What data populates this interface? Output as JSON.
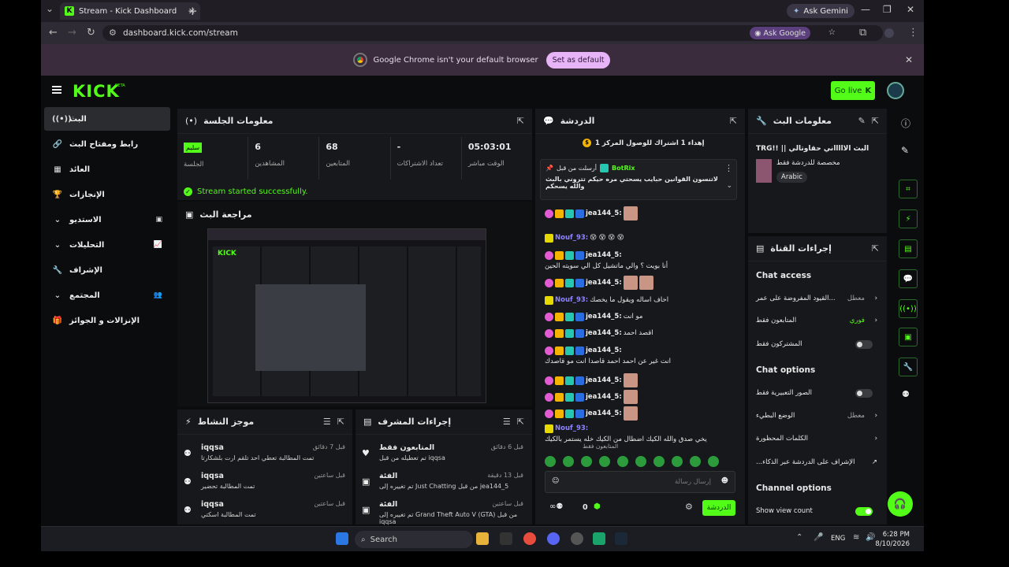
{
  "browser": {
    "tab_title": "Stream - Kick Dashboard",
    "url": "dashboard.kick.com/stream",
    "ask_gemini": "Ask Gemini",
    "ask_google": "Ask Google",
    "infobar_text": "Google Chrome isn't your default browser",
    "set_default": "Set as default"
  },
  "header": {
    "logo": "KICK",
    "beta": "BETA",
    "go_live": "Go live"
  },
  "sidebar": {
    "items": [
      {
        "label": "البث",
        "icon": "((•))"
      },
      {
        "label": "رابط ومفتاح البث",
        "icon": "🔗"
      },
      {
        "label": "العائد",
        "icon": "▦"
      },
      {
        "label": "الإنجازات",
        "icon": "🏆"
      },
      {
        "label": "الاستديو",
        "icon": "▣"
      },
      {
        "label": "التحليلات",
        "icon": "📈"
      },
      {
        "label": "الإشراف",
        "icon": "🔧"
      },
      {
        "label": "المجتمع",
        "icon": "👥"
      },
      {
        "label": "الإنزالات و الجوائز",
        "icon": "🎁"
      }
    ]
  },
  "session": {
    "title": "معلومات الجلسة",
    "stats": [
      {
        "value": "سليم",
        "label": "الجلسة"
      },
      {
        "value": "6",
        "label": "المشاهدين"
      },
      {
        "value": "68",
        "label": "المتابعين"
      },
      {
        "value": "-",
        "label": "تعداد الاشتراكات"
      },
      {
        "value": "05:03:01",
        "label": "الوقت مباشر"
      }
    ],
    "success": "Stream started successfully.",
    "preview_title": "مراجعة البث"
  },
  "activity": {
    "title": "موجز النشاط",
    "rows": [
      {
        "name": "iqqsa",
        "desc": "تمت المطالبة تعطي احد تلقم ارت بلشكارتا",
        "time": "قبل 7 دقائق"
      },
      {
        "name": "iqqsa",
        "desc": "تمت المطالبة تحضير",
        "time": "قبل ساعتين"
      },
      {
        "name": "iqqsa",
        "desc": "تمت المطالبة اسكتي",
        "time": "قبل ساعتين"
      }
    ]
  },
  "mod": {
    "title": "إجراءات المشرف",
    "rows": [
      {
        "name": "المتابعون فقط",
        "desc": "تم تعطيله من قبل iqqsa",
        "time": "قبل 6 دقائق"
      },
      {
        "name": "الفئة",
        "desc": "تم تغييره إلى Just Chatting من قبل jea144_5",
        "time": "قبل 13 دقيقة"
      },
      {
        "name": "الفئة",
        "desc": "تم تغييره إلى Grand Theft Auto V (GTA) من قبل iqqsa",
        "time": "قبل ساعتين"
      }
    ]
  },
  "chat": {
    "title": "الدردشة",
    "banner": "إهداء 1 اشتراك للوصول المركز 1",
    "pinned_by": "أرسلت من قبل",
    "pinned_user": "BotRix",
    "pinned_text": "لاتنسون القوانين حبايب يسحتي مره حيكم تتروني بالبث واللّه يسحكم",
    "messages": [
      {
        "user": "jea144_5:",
        "text": ""
      },
      {
        "user": "Nouf_93:",
        "text": "😵 😵 😵 😵"
      },
      {
        "user": "jea144_5:",
        "text": "أنا بويت ؟ والي ماتشيل كل الي سويته الحين"
      },
      {
        "user": "jea144_5:",
        "text": ""
      },
      {
        "user": "Nouf_93:",
        "text": "اخاف اساله ويقول ما يخصك"
      },
      {
        "user": "jea144_5:",
        "text": "مو انت"
      },
      {
        "user": "jea144_5:",
        "text": "اقصد احمد"
      },
      {
        "user": "jea144_5:",
        "text": "انت غير عن احمد احمد قاصدا انت مو قاصدك"
      },
      {
        "user": "jea144_5:",
        "text": ""
      },
      {
        "user": "jea144_5:",
        "text": ""
      },
      {
        "user": "jea144_5:",
        "text": ""
      },
      {
        "user": "Nouf_93:",
        "text": "يخي صدق والله الكيك اضطال من الكيك خله يستمر بالكيك"
      }
    ],
    "followers_only": "المتابعون فقط",
    "input_placeholder": "إرسال رسالة",
    "points": "0",
    "send": "الدردشة"
  },
  "stream_info": {
    "title": "معلومات البث",
    "stream_title": "TRG!! || البث الاااااني حقاوتالي",
    "subtitle": "مخصصة للدردشة فقط",
    "tag": "Arabic"
  },
  "channel_actions": {
    "title": "إجراءات القناة",
    "chat_access": "Chat access",
    "rows_access": [
      {
        "label": "القيود المفروضة على عمر...",
        "value": "معطل"
      },
      {
        "label": "المتابعون فقط",
        "value": "فوري"
      },
      {
        "label": "المشتركون فقط",
        "value": ""
      }
    ],
    "chat_options": "Chat options",
    "rows_options": [
      {
        "label": "الصور التعبيرية فقط",
        "value": ""
      },
      {
        "label": "الوضع البطيء",
        "value": "معطل"
      },
      {
        "label": "الكلمات المحظورة",
        "value": ""
      },
      {
        "label": "...الإشراف على الدردشة عبر الذكاء",
        "value": ""
      }
    ],
    "channel_options": "Channel options",
    "show_view_count": "Show view count"
  },
  "taskbar": {
    "search": "Search",
    "lang": "ENG",
    "time": "6:28 PM",
    "date": "8/10/2026"
  }
}
